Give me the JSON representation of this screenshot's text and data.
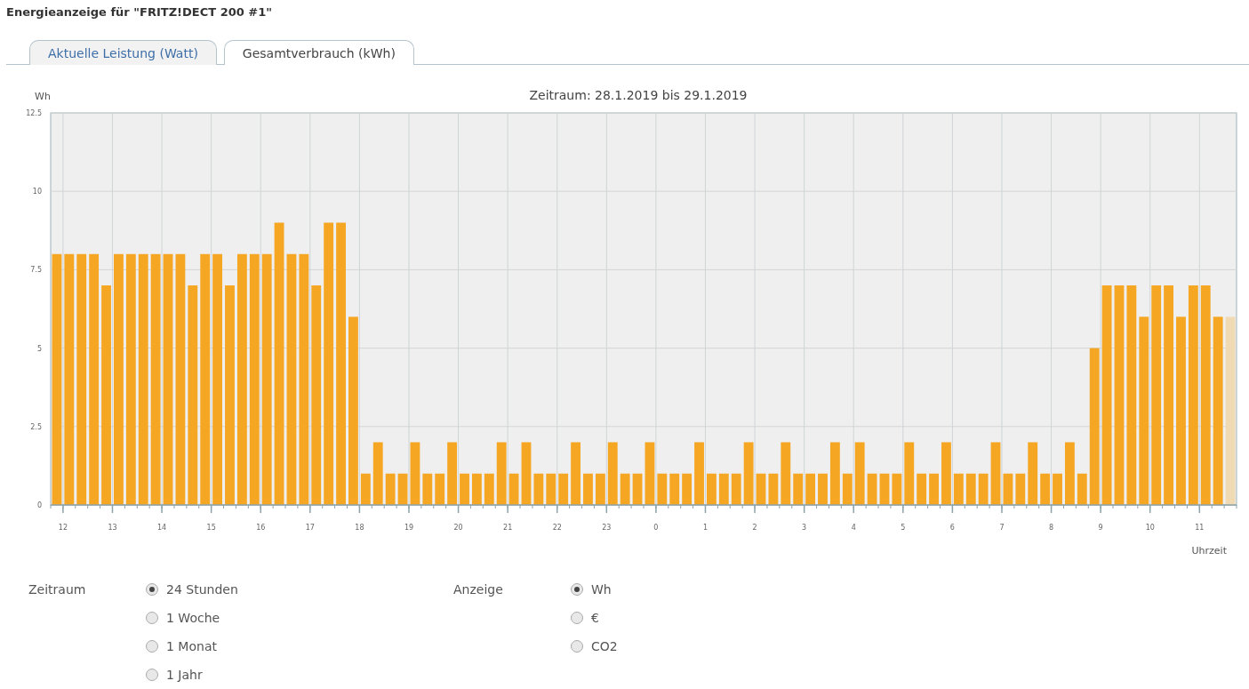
{
  "title": "Energieanzeige für \"FRITZ!DECT 200 #1\"",
  "tabs": [
    {
      "label": "Aktuelle Leistung (Watt)",
      "selected": false
    },
    {
      "label": "Gesamtverbrauch (kWh)",
      "selected": true
    }
  ],
  "chart_data": {
    "type": "bar",
    "title": "Zeitraum: 28.1.2019 bis 29.1.2019",
    "xlabel": "Uhrzeit",
    "ylabel": "Wh",
    "categories": [
      null,
      "12",
      null,
      null,
      null,
      "13",
      null,
      null,
      null,
      "14",
      null,
      null,
      null,
      "15",
      null,
      null,
      null,
      "16",
      null,
      null,
      null,
      "17",
      null,
      null,
      null,
      "18",
      null,
      null,
      null,
      "19",
      null,
      null,
      null,
      "20",
      null,
      null,
      null,
      "21",
      null,
      null,
      null,
      "22",
      null,
      null,
      null,
      "23",
      null,
      null,
      null,
      "0",
      null,
      null,
      null,
      "1",
      null,
      null,
      null,
      "2",
      null,
      null,
      null,
      "3",
      null,
      null,
      null,
      "4",
      null,
      null,
      null,
      "5",
      null,
      null,
      null,
      "6",
      null,
      null,
      null,
      "7",
      null,
      null,
      null,
      "8",
      null,
      null,
      null,
      "9",
      null,
      null,
      null,
      "10",
      null,
      null,
      null,
      "11",
      null,
      null
    ],
    "series": [
      {
        "color": "#f5a623",
        "values": [
          8,
          8,
          8,
          8,
          7,
          8,
          8,
          8,
          8,
          8,
          8,
          7,
          8,
          8,
          7,
          8,
          8,
          8,
          9,
          8,
          8,
          7,
          9,
          9,
          6,
          1,
          2,
          1,
          1,
          2,
          1,
          1,
          2,
          1,
          1,
          1,
          2,
          1,
          2,
          1,
          1,
          1,
          2,
          1,
          1,
          2,
          1,
          1,
          2,
          1,
          1,
          1,
          2,
          1,
          1,
          1,
          2,
          1,
          1,
          2,
          1,
          1,
          1,
          2,
          1,
          2,
          1,
          1,
          1,
          2,
          1,
          1,
          2,
          1,
          1,
          1,
          2,
          1,
          1,
          2,
          1,
          1,
          2,
          1,
          5,
          7,
          7,
          7,
          6,
          7,
          7,
          6,
          7,
          7,
          6,
          null
        ]
      },
      {
        "color": "#f0dab4",
        "values": [
          null,
          null,
          null,
          null,
          null,
          null,
          null,
          null,
          null,
          null,
          null,
          null,
          null,
          null,
          null,
          null,
          null,
          null,
          null,
          null,
          null,
          null,
          null,
          null,
          null,
          null,
          null,
          null,
          null,
          null,
          null,
          null,
          null,
          null,
          null,
          null,
          null,
          null,
          null,
          null,
          null,
          null,
          null,
          null,
          null,
          null,
          null,
          null,
          null,
          null,
          null,
          null,
          null,
          null,
          null,
          null,
          null,
          null,
          null,
          null,
          null,
          null,
          null,
          null,
          null,
          null,
          null,
          null,
          null,
          null,
          null,
          null,
          null,
          null,
          null,
          null,
          null,
          null,
          null,
          null,
          null,
          null,
          null,
          null,
          null,
          null,
          null,
          null,
          null,
          null,
          null,
          null,
          null,
          null,
          null,
          6
        ]
      }
    ],
    "ylim": [
      0,
      12.5
    ],
    "yticks": [
      0,
      2.5,
      5,
      7.5,
      10,
      12.5
    ],
    "grid": true
  },
  "period": {
    "label": "Zeitraum",
    "options": [
      {
        "label": "24 Stunden",
        "selected": true
      },
      {
        "label": "1 Woche",
        "selected": false
      },
      {
        "label": "1 Monat",
        "selected": false
      },
      {
        "label": "1 Jahr",
        "selected": false
      }
    ]
  },
  "display": {
    "label": "Anzeige",
    "options": [
      {
        "label": "Wh",
        "selected": true
      },
      {
        "label": "€",
        "selected": false
      },
      {
        "label": "CO2",
        "selected": false
      }
    ]
  }
}
